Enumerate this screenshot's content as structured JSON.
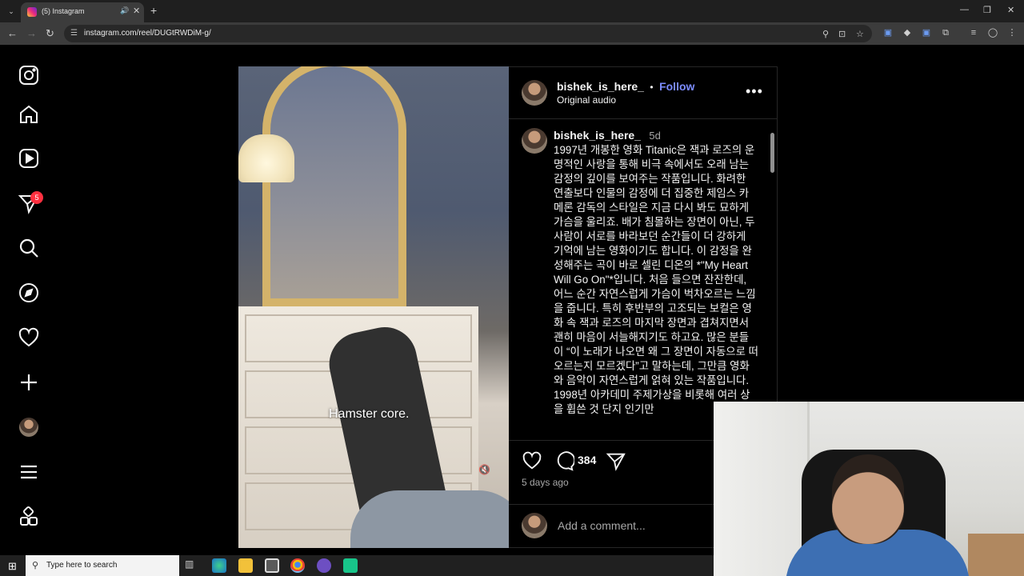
{
  "browser": {
    "tab_title": "(5) Instagram",
    "url": "instagram.com/reel/DUGtRWDiM-g/",
    "icons": [
      "tab-search-icon",
      "mute-icon",
      "close-icon",
      "new-tab-icon",
      "back-icon",
      "forward-icon",
      "reload-icon",
      "site-info-icon",
      "zoom-icon",
      "install-icon",
      "bookmark-star-icon",
      "extension-icon",
      "media-icon",
      "profile-icon",
      "kebab-menu-icon"
    ]
  },
  "sidebar": {
    "notification_count": "5",
    "items": [
      "instagram-logo-icon",
      "home-icon",
      "reels-icon",
      "messages-icon",
      "search-icon",
      "explore-icon",
      "notifications-icon",
      "create-icon",
      "profile-avatar",
      "more-menu-icon",
      "also-from-meta-icon"
    ]
  },
  "video": {
    "subtitle": "Hamster core."
  },
  "post": {
    "username": "bishek_is_here_",
    "separator": "•",
    "follow_label": "Follow",
    "audio": "Original audio",
    "comment_username": "bishek_is_here_",
    "comment_time": "5d",
    "caption": "1997년 개봉한 영화 Titanic은 잭과 로즈의 운명적인 사랑을 통해 비극 속에서도 오래 남는 감정의 깊이를 보여주는 작품입니다. 화려한 연출보다 인물의 감정에 더 집중한 제임스 카메론 감독의 스타일은 지금 다시 봐도 묘하게 가슴을 울리죠. 배가 침몰하는 장면이 아닌, 두 사람이 서로를 바라보던 순간들이 더 강하게 기억에 남는 영화이기도 합니다. 이 감정을 완성해주는 곡이 바로 셀린 디온의 *\"My Heart Will Go On\"*입니다. 처음 들으면 잔잔한데, 어느 순간 자연스럽게 가슴이 벅차오르는 느낌을 줍니다. 특히 후반부의 고조되는 보컬은 영화 속 잭과 로즈의 마지막 장면과 겹쳐지면서 괜히 마음이 서늘해지기도 하고요. 많은 분들이 “이 노래가 나오면 왜 그 장면이 자동으로 떠오르는지 모르겠다”고 말하는데, 그만큼 영화와 음악이 자연스럽게 얽혀 있는 작품입니다. 1998년 아카데미 주제가상을 비롯해 여러 상을 휩쓴 것 단지 인기만",
    "comment_count": "384",
    "posted_ago": "5 days ago",
    "add_comment_placeholder": "Add a comment..."
  },
  "taskbar": {
    "search_placeholder": "Type here to search"
  },
  "colors": {
    "follow": "#7c8cff",
    "badge": "#ff3040",
    "background": "#000000"
  }
}
